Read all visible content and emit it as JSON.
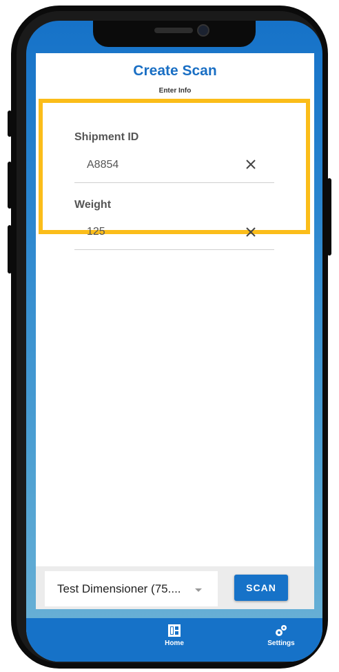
{
  "header": {
    "title": "Create Scan",
    "subtitle": "Enter Info"
  },
  "form": {
    "fields": [
      {
        "label": "Shipment ID",
        "value": "A8854",
        "clear_icon": "close-icon"
      },
      {
        "label": "Weight",
        "value": "125",
        "clear_icon": "close-icon"
      }
    ],
    "highlight_color": "#fbbd1a"
  },
  "footer": {
    "device_select": {
      "selected": "Test Dimensioner (75...."
    },
    "scan_button": "SCAN"
  },
  "tabs": [
    {
      "label": "Home",
      "icon": "home-grid-icon"
    },
    {
      "label": "Settings",
      "icon": "gears-icon"
    }
  ],
  "colors": {
    "brand": "#1672c8",
    "highlight": "#fbbd1a"
  }
}
